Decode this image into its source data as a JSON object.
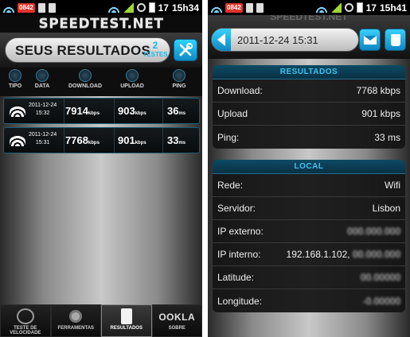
{
  "left": {
    "status": {
      "badge": "0842",
      "battery": "17",
      "time": "15h34"
    },
    "logo": "SPEEDTEST.NET",
    "header": {
      "title": "SEUS RESULTADOS",
      "count": "2",
      "count_label": "TESTES"
    },
    "columns": [
      "TIPO",
      "DATA",
      "DOWNLOAD",
      "UPLOAD",
      "PING"
    ],
    "rows": [
      {
        "date": "2011-12-24",
        "time": "15:32",
        "download": "7914",
        "upload": "903",
        "ping": "36",
        "download_unit": "kbps",
        "upload_unit": "kbps",
        "ping_unit": "ms"
      },
      {
        "date": "2011-12-24",
        "time": "15:31",
        "download": "7768",
        "upload": "901",
        "ping": "33",
        "download_unit": "kbps",
        "upload_unit": "kbps",
        "ping_unit": "ms"
      }
    ],
    "tabs": [
      {
        "label": "TESTE DE VELOCIDADE",
        "icon": "speedometer-icon"
      },
      {
        "label": "FERRAMENTAS",
        "icon": "gear-icon"
      },
      {
        "label": "RESULTADOS",
        "icon": "document-icon"
      },
      {
        "label": "SOBRE",
        "icon": "ookla-logo",
        "brand": "OOKLA"
      }
    ]
  },
  "right": {
    "status": {
      "badge": "0842",
      "battery": "17",
      "time": "15h41"
    },
    "logo": "SPEEDTEST.NET",
    "datetime": "2011-12-24 15:31",
    "resultados": {
      "title": "RESULTADOS",
      "rows": [
        {
          "label": "Download:",
          "value": "7768 kbps"
        },
        {
          "label": "Upload",
          "value": "901 kbps"
        },
        {
          "label": "Ping:",
          "value": "33 ms"
        }
      ]
    },
    "local": {
      "title": "LOCAL",
      "rows": [
        {
          "label": "Rede:",
          "value": "Wifi"
        },
        {
          "label": "Servidor:",
          "value": "Lisbon"
        },
        {
          "label": "IP externo:",
          "value": ""
        },
        {
          "label": "IP interno:",
          "value": "192.168.1.102,"
        },
        {
          "label": "Latitude:",
          "value": ""
        },
        {
          "label": "Longitude:",
          "value": ""
        }
      ]
    }
  },
  "colors": {
    "accent": "#17b8e8",
    "badge": "#e0342c",
    "signal": "#9fd637"
  }
}
